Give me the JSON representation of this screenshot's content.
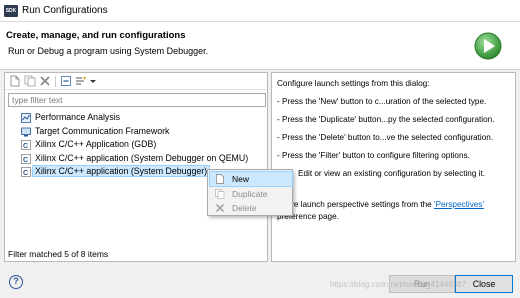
{
  "window": {
    "icon_text": "SDK",
    "title": "Run Configurations"
  },
  "header": {
    "title": "Create, manage, and run configurations",
    "description": "Run or Debug a program using System Debugger.",
    "run_icon": "run-icon",
    "accent_color": "#3a9c3a"
  },
  "toolbar": {
    "icons": [
      "new-config-icon",
      "duplicate-icon",
      "delete-icon",
      "collapse-all-icon",
      "filter-icon",
      "chevron-down-icon"
    ]
  },
  "filter": {
    "placeholder": "type filter text",
    "value": ""
  },
  "tree": {
    "items": [
      {
        "label": "Performance Analysis",
        "icon": "performance-icon"
      },
      {
        "label": "Target Communication Framework",
        "icon": "tcf-icon"
      },
      {
        "label": "Xilinx C/C++ Application (GDB)",
        "icon": "c-app-icon"
      },
      {
        "label": "Xilinx C/C++ application (System Debugger on QEMU)",
        "icon": "c-app-icon"
      },
      {
        "label": "Xilinx C/C++ application (System Debugger)",
        "icon": "c-app-icon",
        "selected": true
      }
    ],
    "status": "Filter matched 5 of 8 items"
  },
  "context_menu": {
    "items": [
      {
        "label": "New",
        "enabled": true
      },
      {
        "label": "Duplicate",
        "enabled": false
      },
      {
        "label": "Delete",
        "enabled": false
      }
    ]
  },
  "right_panel": {
    "intro": "Configure launch settings from this dialog:",
    "lines": [
      "- Press the 'New' button to c...uration of the selected type.",
      "- Press the 'Duplicate' button...py the selected configuration.",
      "- Press the 'Delete' button to...ve the selected configuration.",
      "- Press the 'Filter' button to configure filtering options.",
      "Edit or view an existing configuration by selecting it."
    ],
    "perspective_prefix": "gure launch perspective settings from the ",
    "perspective_link": "'Perspectives'",
    "perspective_suffix": "preference page."
  },
  "buttons": {
    "help": "?",
    "run": "Run",
    "close": "Close"
  },
  "watermark": "https://blog.csdn.net/weixin_41445387"
}
